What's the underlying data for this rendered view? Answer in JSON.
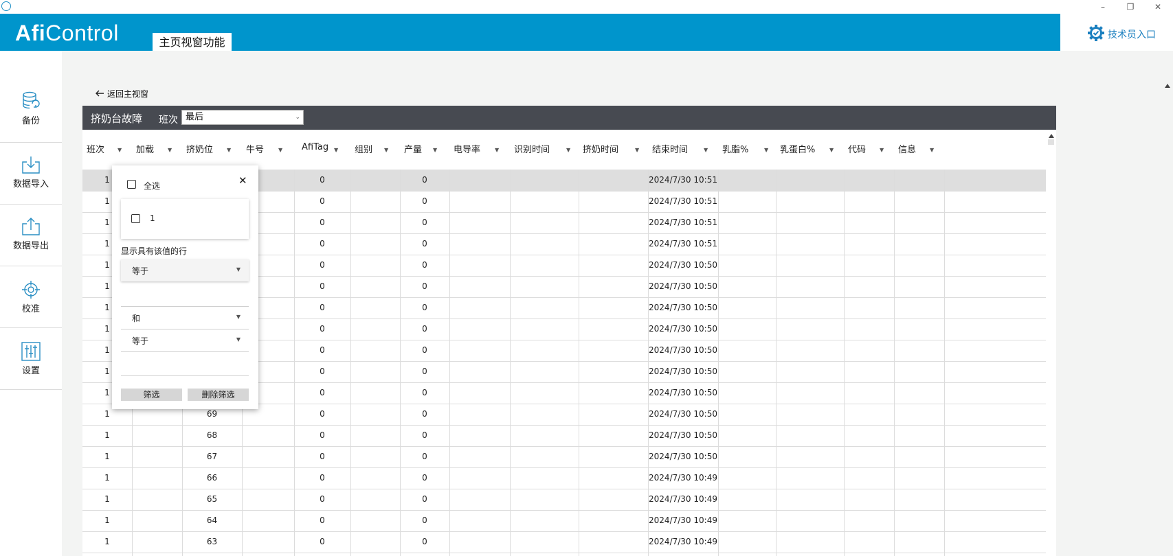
{
  "window": {
    "minimize_glyph": "–",
    "restore_glyph": "❐",
    "close_glyph": "✕"
  },
  "header": {
    "logo_bold": "Afi",
    "logo_light": "Control",
    "main_tab": "主页视窗功能",
    "tech_entry": "技术员入口"
  },
  "sidebar": {
    "items": [
      {
        "label": "备份",
        "icon": "database-icon"
      },
      {
        "label": "数据导入",
        "icon": "import-icon"
      },
      {
        "label": "数据导出",
        "icon": "export-icon"
      },
      {
        "label": "校准",
        "icon": "crosshair-icon"
      },
      {
        "label": "设置",
        "icon": "sliders-icon"
      }
    ]
  },
  "page": {
    "back_link": "返回主视窗",
    "title": "挤奶台故障",
    "shift_label": "班次",
    "shift_value": "最后"
  },
  "grid": {
    "columns": [
      "班次",
      "加载",
      "挤奶位",
      "牛号",
      "AfiTag",
      "组别",
      "产量",
      "电导率",
      "识别时间",
      "挤奶时间",
      "结束时间",
      "乳脂%",
      "乳蛋白%",
      "代码",
      "信息"
    ],
    "rows": [
      {
        "shift": "1",
        "stall": "",
        "afitag": "0",
        "yield": "0",
        "end_time": "2024/7/30 10:51",
        "selected": true
      },
      {
        "shift": "1",
        "stall": "",
        "afitag": "0",
        "yield": "0",
        "end_time": "2024/7/30 10:51"
      },
      {
        "shift": "1",
        "stall": "",
        "afitag": "0",
        "yield": "0",
        "end_time": "2024/7/30 10:51"
      },
      {
        "shift": "1",
        "stall": "",
        "afitag": "0",
        "yield": "0",
        "end_time": "2024/7/30 10:51"
      },
      {
        "shift": "1",
        "stall": "",
        "afitag": "0",
        "yield": "0",
        "end_time": "2024/7/30 10:50"
      },
      {
        "shift": "1",
        "stall": "",
        "afitag": "0",
        "yield": "0",
        "end_time": "2024/7/30 10:50"
      },
      {
        "shift": "1",
        "stall": "",
        "afitag": "0",
        "yield": "0",
        "end_time": "2024/7/30 10:50"
      },
      {
        "shift": "1",
        "stall": "",
        "afitag": "0",
        "yield": "0",
        "end_time": "2024/7/30 10:50"
      },
      {
        "shift": "1",
        "stall": "",
        "afitag": "0",
        "yield": "0",
        "end_time": "2024/7/30 10:50"
      },
      {
        "shift": "1",
        "stall": "",
        "afitag": "0",
        "yield": "0",
        "end_time": "2024/7/30 10:50"
      },
      {
        "shift": "1",
        "stall": "",
        "afitag": "0",
        "yield": "0",
        "end_time": "2024/7/30 10:50"
      },
      {
        "shift": "1",
        "stall": "69",
        "afitag": "0",
        "yield": "0",
        "end_time": "2024/7/30 10:50"
      },
      {
        "shift": "1",
        "stall": "68",
        "afitag": "0",
        "yield": "0",
        "end_time": "2024/7/30 10:50"
      },
      {
        "shift": "1",
        "stall": "67",
        "afitag": "0",
        "yield": "0",
        "end_time": "2024/7/30 10:50"
      },
      {
        "shift": "1",
        "stall": "66",
        "afitag": "0",
        "yield": "0",
        "end_time": "2024/7/30 10:49"
      },
      {
        "shift": "1",
        "stall": "65",
        "afitag": "0",
        "yield": "0",
        "end_time": "2024/7/30 10:49"
      },
      {
        "shift": "1",
        "stall": "64",
        "afitag": "0",
        "yield": "0",
        "end_time": "2024/7/30 10:49"
      },
      {
        "shift": "1",
        "stall": "63",
        "afitag": "0",
        "yield": "0",
        "end_time": "2024/7/30 10:49"
      }
    ]
  },
  "filter_popup": {
    "select_all": "全选",
    "value_1": "1",
    "close_glyph": "✕",
    "show_rows_label": "显示具有该值的行",
    "operator_1": "等于",
    "logic": "和",
    "operator_2": "等于",
    "filter_button": "筛选",
    "clear_button": "删除筛选"
  }
}
